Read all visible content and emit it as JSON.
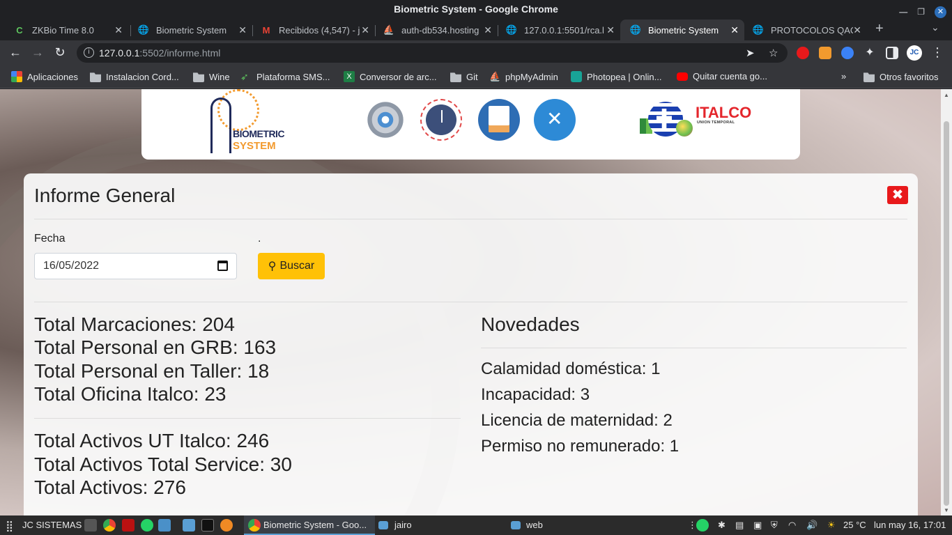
{
  "window": {
    "title": "Biometric System - Google Chrome"
  },
  "tabs": [
    {
      "label": "ZKBio Time 8.0",
      "icon": "zkbio-icon",
      "active": false
    },
    {
      "label": "Biometric System",
      "icon": "globe-icon",
      "active": false
    },
    {
      "label": "Recibidos (4,547) - j",
      "icon": "gmail-icon",
      "active": false
    },
    {
      "label": "auth-db534.hosting",
      "icon": "phpmyadmin-icon",
      "active": false
    },
    {
      "label": "127.0.0.1:5501/rca.l",
      "icon": "globe-icon",
      "active": false
    },
    {
      "label": "Biometric System",
      "icon": "globe-icon",
      "active": true
    },
    {
      "label": "PROTOCOLOS QAC",
      "icon": "globe-icon",
      "active": false
    }
  ],
  "address_bar": {
    "host": "127.0.0.1",
    "rest": ":5502/informe.html"
  },
  "bookmarks": [
    {
      "label": "Aplicaciones",
      "icon": "apps-grid-icon"
    },
    {
      "label": "Instalacion Cord...",
      "icon": "folder-icon"
    },
    {
      "label": "Wine",
      "icon": "folder-icon"
    },
    {
      "label": "Plataforma SMS...",
      "icon": "paper-plane-icon"
    },
    {
      "label": "Conversor de arc...",
      "icon": "excel-icon"
    },
    {
      "label": "Git",
      "icon": "folder-icon"
    },
    {
      "label": "phpMyAdmin",
      "icon": "phpmyadmin-icon"
    },
    {
      "label": "Photopea | Onlin...",
      "icon": "photopea-icon"
    },
    {
      "label": "Quitar cuenta go...",
      "icon": "youtube-icon"
    }
  ],
  "bookmarks_other": "Otros favoritos",
  "header": {
    "logo_line1": "BIOMETRIC",
    "logo_line2": "SYSTEM",
    "italco_name": "ITALCO",
    "italco_sub": "UNION TEMPORAL"
  },
  "report": {
    "title": "Informe General",
    "close_label": "✖",
    "date_label": "Fecha",
    "dot_label": ".",
    "date_value": "16/05/2022",
    "search_label": "Buscar",
    "stats_top": [
      "Total Marcaciones: 204",
      "Total Personal en GRB: 163",
      "Total Personal en Taller: 18",
      "Total Oficina Italco: 23"
    ],
    "stats_bottom": [
      "Total Activos UT Italco: 246",
      "Total Activos Total Service: 30",
      "Total Activos: 276"
    ],
    "novedades_title": "Novedades",
    "novedades": [
      "Calamidad doméstica: 1",
      "Incapacidad: 3",
      "Licencia de maternidad: 2",
      "Permiso no remunerado: 1"
    ]
  },
  "taskbar": {
    "menu_label": "JC SISTEMAS",
    "active_window": "Biometric System - Goo...",
    "folder1": "jairo",
    "folder2": "web",
    "temperature": "25 °C",
    "clock": "lun may 16, 17:01"
  },
  "colors": {
    "accent_yellow": "#ffc107",
    "close_red": "#e8191b",
    "chrome_dark": "#202124"
  }
}
